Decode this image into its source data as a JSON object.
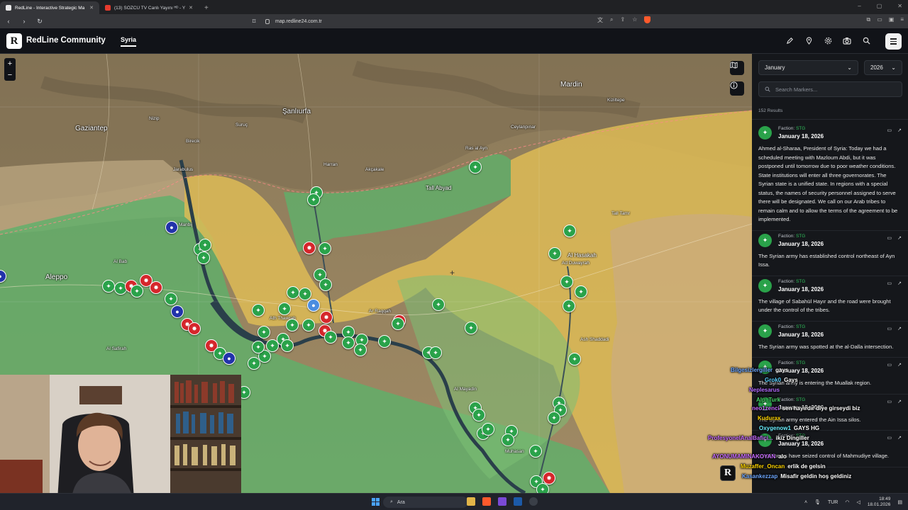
{
  "browser": {
    "tabs": [
      {
        "title": "RedLine - Interactive Strategic Ma",
        "active": true
      },
      {
        "title": "(13) SÖZCÜ TV Canlı Yayını ᴴᴰ - Y",
        "active": false
      }
    ],
    "url": "map.redline24.com.tr"
  },
  "app": {
    "logo_letter": "R",
    "brand": "RedLine Community",
    "nav_tab": "Syria",
    "header_icons": [
      "pen-icon",
      "pin-icon",
      "settings-icon",
      "camera-icon",
      "search-icon",
      "menu-icon"
    ]
  },
  "map": {
    "zoom_in": "+",
    "zoom_out": "−",
    "territory_colors": {
      "government": "#57b36a",
      "sdf": "#e2bf57",
      "turkish": "#c9b9a0"
    },
    "cities": [
      {
        "name": "Gaziantep",
        "size": "big"
      },
      {
        "name": "Şanlıurfa",
        "size": "big"
      },
      {
        "name": "Mardin",
        "size": "big"
      },
      {
        "name": "Aleppo",
        "size": "big"
      },
      {
        "name": "Al Hasakah",
        "size": "normal"
      },
      {
        "name": "Tall Abyad",
        "size": "normal"
      },
      {
        "name": "Ad Duwayrah",
        "size": "sm"
      },
      {
        "name": "Kiziltepe",
        "size": "sm"
      },
      {
        "name": "Akçakale",
        "size": "sm"
      },
      {
        "name": "Ceylanpınar",
        "size": "sm"
      },
      {
        "name": "Harran",
        "size": "sm"
      },
      {
        "name": "Suruç",
        "size": "sm"
      },
      {
        "name": "Nizip",
        "size": "sm"
      },
      {
        "name": "Birecik",
        "size": "sm"
      },
      {
        "name": "Jarabulus",
        "size": "sm"
      },
      {
        "name": "Manbij",
        "size": "sm"
      },
      {
        "name": "Al Bab",
        "size": "sm"
      },
      {
        "name": "Ar Raqqah",
        "size": "sm"
      },
      {
        "name": "Ath Thawrah",
        "size": "sm"
      },
      {
        "name": "Muhasan",
        "size": "sm"
      },
      {
        "name": "Al Mayadin",
        "size": "sm"
      },
      {
        "name": "Ash Shaddadi",
        "size": "sm"
      },
      {
        "name": "Ras al Ayn",
        "size": "sm"
      },
      {
        "name": "Tall Tamr",
        "size": "sm"
      },
      {
        "name": "Al Safirah",
        "size": "sm"
      }
    ]
  },
  "sidebar": {
    "month": "January",
    "year": "2026",
    "search_placeholder": "Search Markers...",
    "results": "152 Results",
    "faction_label": "Faction:",
    "items": [
      {
        "faction": "STG",
        "date": "January 18, 2026",
        "text": "Ahmed al-Sharaa, President of Syria: Today we had a scheduled meeting with Mazloum Abdi, but it was postponed until tomorrow due to poor weather conditions. State institutions will enter all three governorates. The Syrian state is a unified state. In regions with a special status, the names of security personnel assigned to serve there will be designated. We call on our Arab tribes to remain calm and to allow the terms of the agreement to be implemented."
      },
      {
        "faction": "STG",
        "date": "January 18, 2026",
        "text": "The Syrian army has established control northeast of Ayn Issa."
      },
      {
        "faction": "STG",
        "date": "January 18, 2026",
        "text": "The village of Sabahül Hayır and the road were brought under the control of the tribes."
      },
      {
        "faction": "STG",
        "date": "January 18, 2026",
        "text": "The Syrian army was spotted at the al-Dalla intersection."
      },
      {
        "faction": "STG",
        "date": "January 18, 2026",
        "text": "The Syrian army is entering the Muallak region."
      },
      {
        "faction": "STG",
        "date": "January 18, 2026",
        "text": "The Syrian army entered the Ain Issa silos."
      },
      {
        "faction": "STG",
        "date": "January 18, 2026",
        "text": "Local forces have seized control of Mahmudiye village."
      }
    ]
  },
  "chat": [
    {
      "user": "Bilgesizlergiller",
      "msg": "gays",
      "color": "#6fa8ff"
    },
    {
      "user": "Grok0",
      "msg": "Gays",
      "color": "#5ad1ff"
    },
    {
      "user": "Neplesarus",
      "msg": "",
      "color": "#b46cff"
    },
    {
      "user": "Alp_Turk",
      "msg": "",
      "color": "#4bd46a"
    },
    {
      "user": "neo1zenci",
      "msg": "sen hayırdır diye girseydi biz",
      "color": "#c86cff"
    },
    {
      "user": "Kudurax",
      "msg": "",
      "color": "#ffd400"
    },
    {
      "user": "Oxygenow1",
      "msg": "GAYS HG",
      "color": "#6cf0ff"
    },
    {
      "user": "ProfesyonelAnalBafici...",
      "msg": "ikiz Dingiller",
      "color": "#c86cff"
    },
    {
      "user": "AYONUMAMINAKOYAN",
      "msg": "alo",
      "color": "#c86cff"
    },
    {
      "user": "Muzaffer_Oncan",
      "msg": "erlik de gelsin",
      "color": "#ffd400"
    },
    {
      "user": "Kasankezzap",
      "msg": "Misafir geldin hoş geldiniz",
      "color": "#6fa8ff"
    }
  ],
  "taskbar": {
    "search_label": "Ara",
    "lang": "TUR",
    "time": "18:49",
    "date": "18.01.2026"
  }
}
